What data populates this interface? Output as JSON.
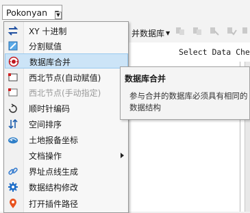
{
  "toolbar": {
    "project_dropdown": "Pokonyan",
    "merge_tool_label": "并数据库"
  },
  "background": {
    "select_data_label": "Select Data Check"
  },
  "menu": {
    "items": [
      {
        "label": "XY 十进制",
        "icon": "xy-arrows-icon",
        "state": "normal"
      },
      {
        "label": "分割赋值",
        "icon": "split-assign-icon",
        "state": "normal"
      },
      {
        "label": "数据库合并",
        "icon": "database-merge-icon",
        "state": "highlighted"
      },
      {
        "label": "西北节点(自动赋值)",
        "icon": "node-auto-icon",
        "state": "normal"
      },
      {
        "label": "西北节点(手动指定)",
        "icon": "node-manual-icon",
        "state": "disabled"
      },
      {
        "label": "顺时针编码",
        "icon": "clockwise-icon",
        "state": "normal"
      },
      {
        "label": "空间排序",
        "icon": "spatial-sort-icon",
        "state": "normal"
      },
      {
        "label": "土地报备坐标",
        "icon": "land-coords-icon",
        "state": "normal"
      },
      {
        "label": "文档操作",
        "icon": "document-icon",
        "state": "normal",
        "submenu": true
      },
      {
        "label": "界址点线生成",
        "icon": "boundary-link-icon",
        "state": "normal"
      },
      {
        "label": "数据结构修改",
        "icon": "gear-icon",
        "state": "normal"
      },
      {
        "label": "打开插件路径",
        "icon": "location-pin-icon",
        "state": "normal"
      }
    ]
  },
  "tooltip": {
    "title": "数据库合并",
    "body": "参与合并的数据库必须具有相同的数据结构"
  },
  "colors": {
    "highlight_bg": "#cce4f7",
    "highlight_border": "#99c9ef",
    "accent_blue": "#1f6fc9"
  }
}
